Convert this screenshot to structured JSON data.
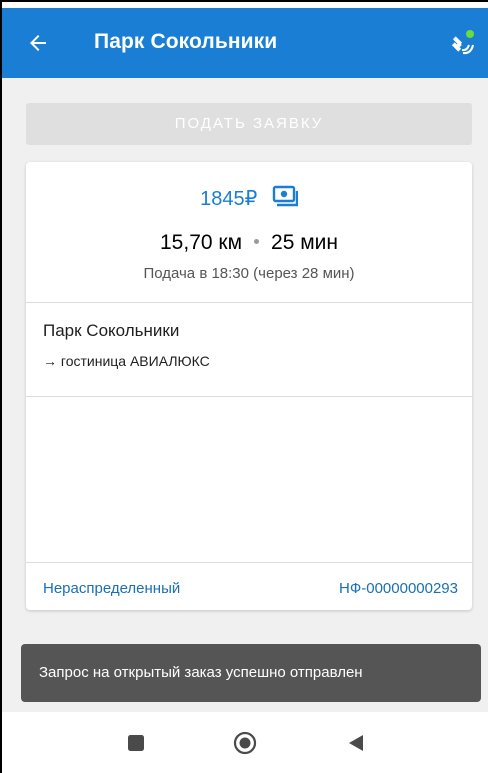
{
  "appbar": {
    "title": "Парк Сокольники",
    "back_icon": "arrow-left-icon",
    "gps_icon": "satellite-gps-icon",
    "color": "#1a7fd4"
  },
  "actions": {
    "submit_label": "ПОДАТЬ ЗАЯВКУ"
  },
  "order": {
    "price": "1845₽",
    "payment_icon": "cash-icon",
    "distance": "15,70 км",
    "duration": "25 мин",
    "pickup": "Подача в 18:30 (через 28 мин)",
    "origin": "Парк Сокольники",
    "destination": "→ гостиница АВИАЛЮКС",
    "status": "Нераспределенный",
    "number": "НФ-00000000293"
  },
  "snackbar": {
    "message": "Запрос на открытый заказ успешно отправлен"
  },
  "navbar": {
    "icons": [
      "square-recents-icon",
      "circle-home-icon",
      "triangle-back-icon"
    ]
  }
}
